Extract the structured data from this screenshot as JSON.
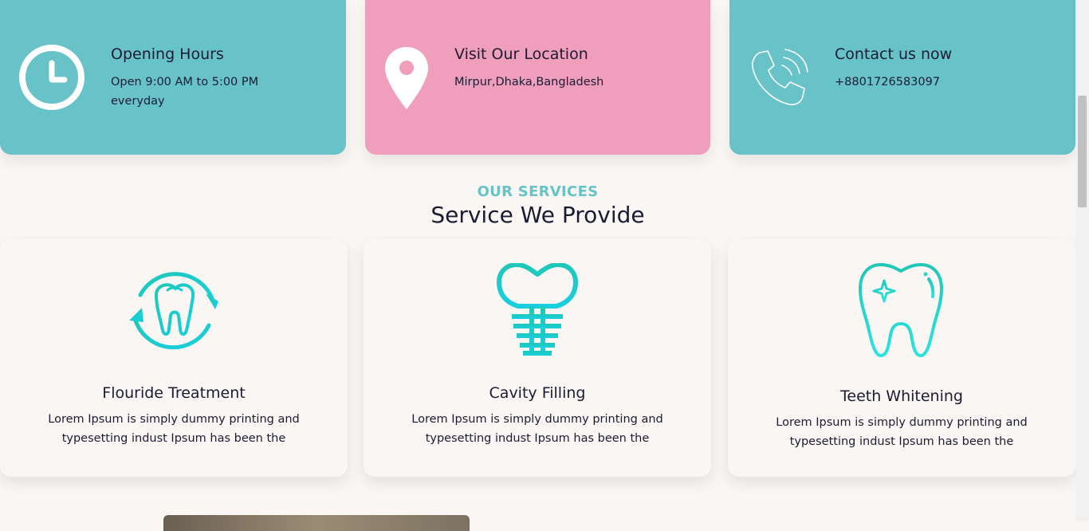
{
  "info_cards": [
    {
      "title": "Opening Hours",
      "text": "Open 9:00 AM to 5:00 PM everyday",
      "icon": "clock-icon",
      "color": "#67c3c8"
    },
    {
      "title": "Visit Our Location",
      "text": "Mirpur,Dhaka,Bangladesh",
      "icon": "location-pin-icon",
      "color": "#ef9ebc"
    },
    {
      "title": "Contact us now",
      "text": "+8801726583097",
      "icon": "phone-icon",
      "color": "#67c3c8"
    }
  ],
  "services_section": {
    "eyebrow": "OUR SERVICES",
    "title": "Service We Provide"
  },
  "services": [
    {
      "title": "Flouride Treatment",
      "description": "Lorem Ipsum is simply dummy printing and typesetting indust Ipsum has been the",
      "icon": "tooth-cycle-icon"
    },
    {
      "title": "Cavity Filling",
      "description": "Lorem Ipsum is simply dummy printing and typesetting indust Ipsum has been the",
      "icon": "dental-implant-icon"
    },
    {
      "title": "Teeth Whitening",
      "description": "Lorem Ipsum is simply dummy printing and typesetting indust Ipsum has been the",
      "icon": "sparkle-tooth-icon"
    }
  ],
  "colors": {
    "teal": "#67c3c8",
    "pink": "#ef9ebc",
    "icon_gradient_start": "#1fc8c8",
    "icon_gradient_end": "#18cfe0",
    "heading": "#1b1c33"
  }
}
